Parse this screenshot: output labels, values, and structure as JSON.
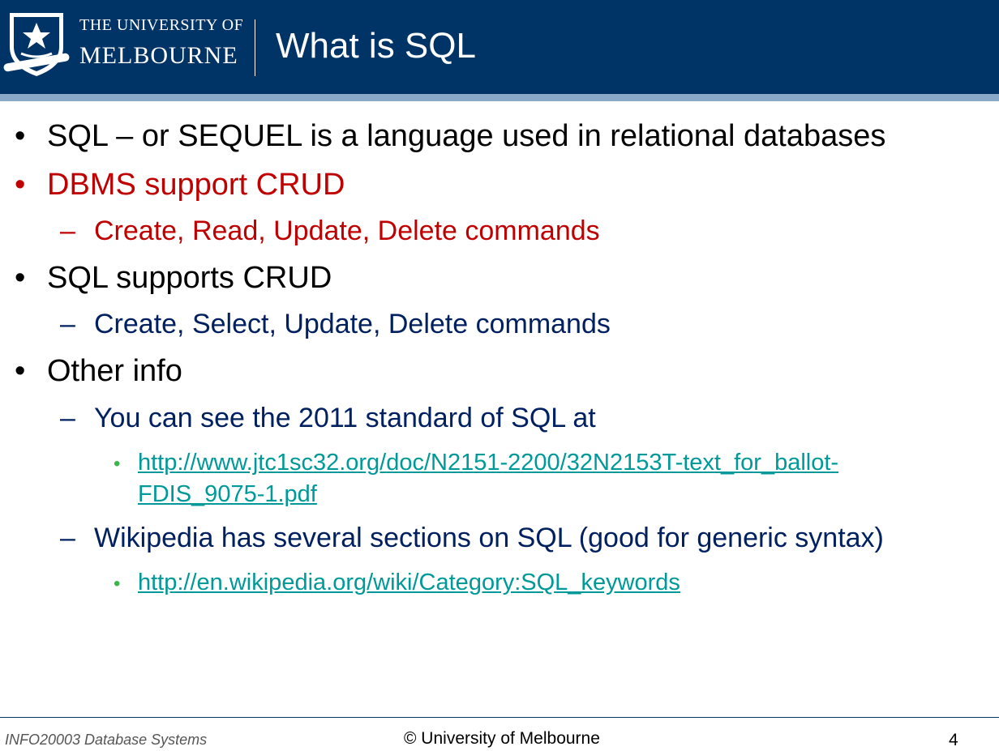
{
  "header": {
    "logo_line1": "THE UNIVERSITY OF",
    "logo_line2": "MELBOURNE",
    "title": "What is SQL"
  },
  "bullets": [
    {
      "level": 1,
      "text": "SQL – or SEQUEL is a language used in relational databases",
      "color": "#000000"
    },
    {
      "level": 1,
      "text": "DBMS support CRUD",
      "color": "#c00000"
    },
    {
      "level": 2,
      "text": "Create, Read, Update, Delete commands",
      "color": "#c00000"
    },
    {
      "level": 1,
      "text": "SQL supports CRUD",
      "color": "#000000"
    },
    {
      "level": 2,
      "text": "Create, Select, Update, Delete commands",
      "color": "#002060"
    },
    {
      "level": 1,
      "text": "Other info",
      "color": "#000000"
    },
    {
      "level": 2,
      "text": "You can see the 2011 standard of SQL at",
      "color": "#002060"
    },
    {
      "level": 3,
      "text_line1": "http://www.jtc1sc32.org/doc/N2151-2200/32N2153T-text_for_ballot-",
      "text_line2": "FDIS_9075-1.pdf",
      "color": "#009999"
    },
    {
      "level": 2,
      "text": "Wikipedia has several sections on SQL (good for generic syntax)",
      "color": "#002060"
    },
    {
      "level": 3,
      "text": "http://en.wikipedia.org/wiki/Category:SQL_keywords",
      "color": "#009999"
    }
  ],
  "footer": {
    "course": "INFO20003 Database Systems",
    "copyright": "© University of Melbourne",
    "page_number": "4"
  }
}
